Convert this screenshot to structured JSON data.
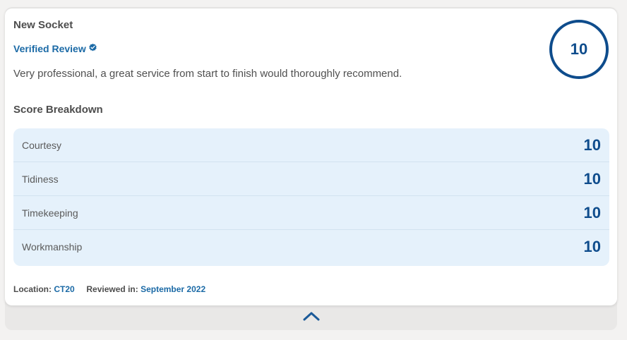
{
  "review": {
    "job_title": "New Socket",
    "verified_label": "Verified Review",
    "text": "Very professional, a great service from start to finish would thoroughly recommend.",
    "overall_score": "10"
  },
  "breakdown": {
    "title": "Score Breakdown",
    "rows": [
      {
        "label": "Courtesy",
        "score": "10"
      },
      {
        "label": "Tidiness",
        "score": "10"
      },
      {
        "label": "Timekeeping",
        "score": "10"
      },
      {
        "label": "Workmanship",
        "score": "10"
      }
    ]
  },
  "meta": {
    "location_label": "Location:",
    "location_value": "CT20",
    "reviewed_label": "Reviewed in:",
    "reviewed_value": "September 2022"
  },
  "icons": {
    "verified": "check-badge-icon",
    "collapse": "chevron-up-icon"
  },
  "colors": {
    "accent": "#1b6aa6",
    "score": "#0e4c8c",
    "breakdown_bg": "#e5f1fb"
  }
}
